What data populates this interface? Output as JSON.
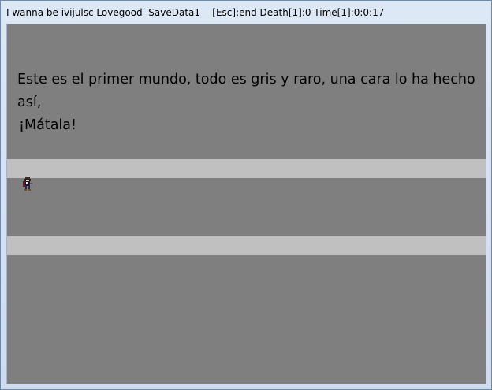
{
  "window": {
    "title": "I wanna be ivijulsc Lovegood  SaveData1    [Esc]:end Death[1]:0 Time[1]:0:0:17"
  },
  "game": {
    "dialog_line1": "Este es el primer mundo, todo es gris y raro, una cara lo ha hecho así,",
    "dialog_line2": "¡Mátala!",
    "colors": {
      "background": "#7f7f7f",
      "platform": "#c0c0c0",
      "text": "#000000"
    },
    "player_sprite": "kid-character-icon"
  }
}
